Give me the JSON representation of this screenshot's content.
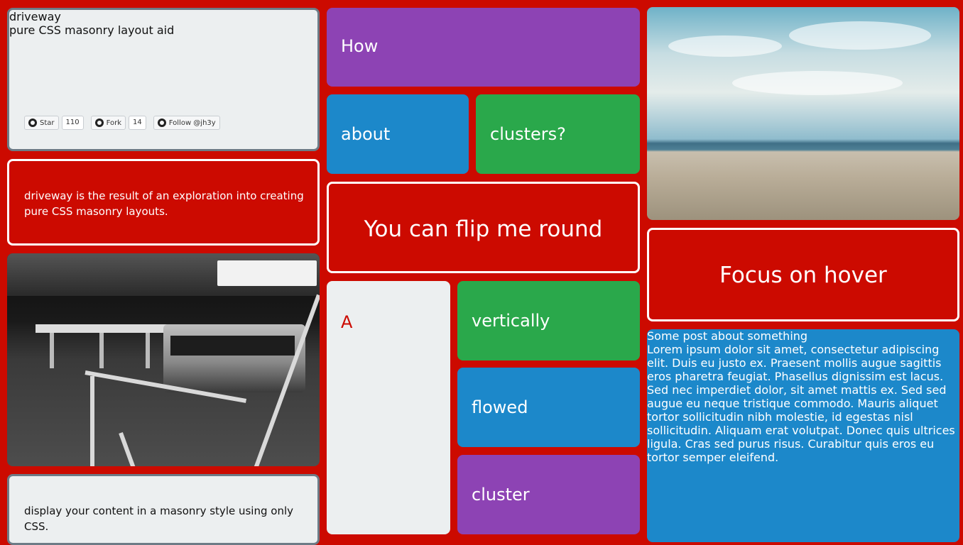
{
  "intro": {
    "title": "driveway",
    "subtitle": "pure CSS masonry layout aid",
    "github": {
      "star_label": "Star",
      "star_count": "110",
      "fork_label": "Fork",
      "fork_count": "14",
      "follow_label": "Follow @jh3y"
    }
  },
  "description": "driveway is the result of an exploration into creating pure CSS masonry layouts.",
  "display_note": "display your content in a masonry style using only CSS.",
  "tiles": {
    "how": "How",
    "about": "about",
    "clusters": "clusters?",
    "flip": "You can flip me round",
    "a": "A",
    "vertically": "vertically",
    "flowed": "flowed",
    "cluster": "cluster",
    "focus": "Focus on hover"
  },
  "post": {
    "title": "Some post about something",
    "body": "Lorem ipsum dolor sit amet, consectetur adipiscing elit. Duis eu justo ex. Praesent mollis augue sagittis eros pharetra feugiat. Phasellus dignissim est lacus. Sed nec imperdiet dolor, sit amet mattis ex. Sed sed augue eu neque tristique commodo. Mauris aliquet tortor sollicitudin nibh molestie, id egestas nisl sollicitudin. Aliquam erat volutpat. Donec quis ultrices ligula. Cras sed purus risus. Curabitur quis eros eu tortor semper eleifend."
  },
  "colors": {
    "background": "#cc0a00",
    "purple": "#8d43b4",
    "blue": "#1c88ca",
    "green": "#2aa84b",
    "light": "#eceff0"
  },
  "icons": {
    "github": "github-icon"
  }
}
